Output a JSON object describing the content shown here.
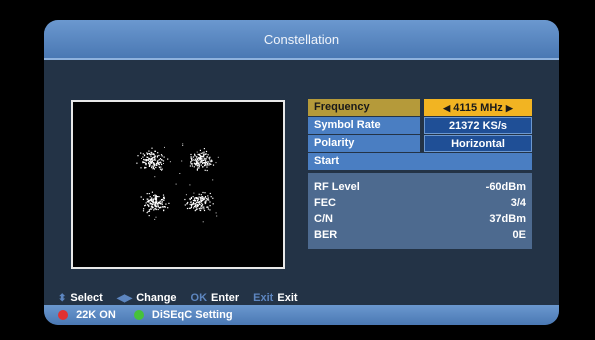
{
  "title": "Constellation",
  "params": {
    "frequency": {
      "label": "Frequency",
      "value": "4115 MHz",
      "left_arrow": "◀",
      "right_arrow": "▶"
    },
    "symbol_rate": {
      "label": "Symbol Rate",
      "value": "21372 KS/s"
    },
    "polarity": {
      "label": "Polarity",
      "value": "Horizontal"
    },
    "start": {
      "label": "Start"
    }
  },
  "info": {
    "rf_level": {
      "label": "RF Level",
      "value": "-60dBm"
    },
    "fec": {
      "label": "FEC",
      "value": "3/4"
    },
    "cn": {
      "label": "C/N",
      "value": "37dBm"
    },
    "ber": {
      "label": "BER",
      "value": "0E"
    }
  },
  "help": {
    "select": {
      "key": "⬍",
      "label": "Select"
    },
    "change": {
      "key": "◀▶",
      "label": "Change"
    },
    "enter": {
      "key": "OK",
      "label": "Enter"
    },
    "exit": {
      "key": "Exit",
      "label": "Exit"
    }
  },
  "footer": {
    "k22": {
      "label": "22K ON",
      "color": "#e23131"
    },
    "diseqc": {
      "label": "DiSEqC Setting",
      "color": "#46c23a"
    }
  },
  "colors": {
    "accent": "#4a7ec2",
    "selected": "#f2b422"
  }
}
